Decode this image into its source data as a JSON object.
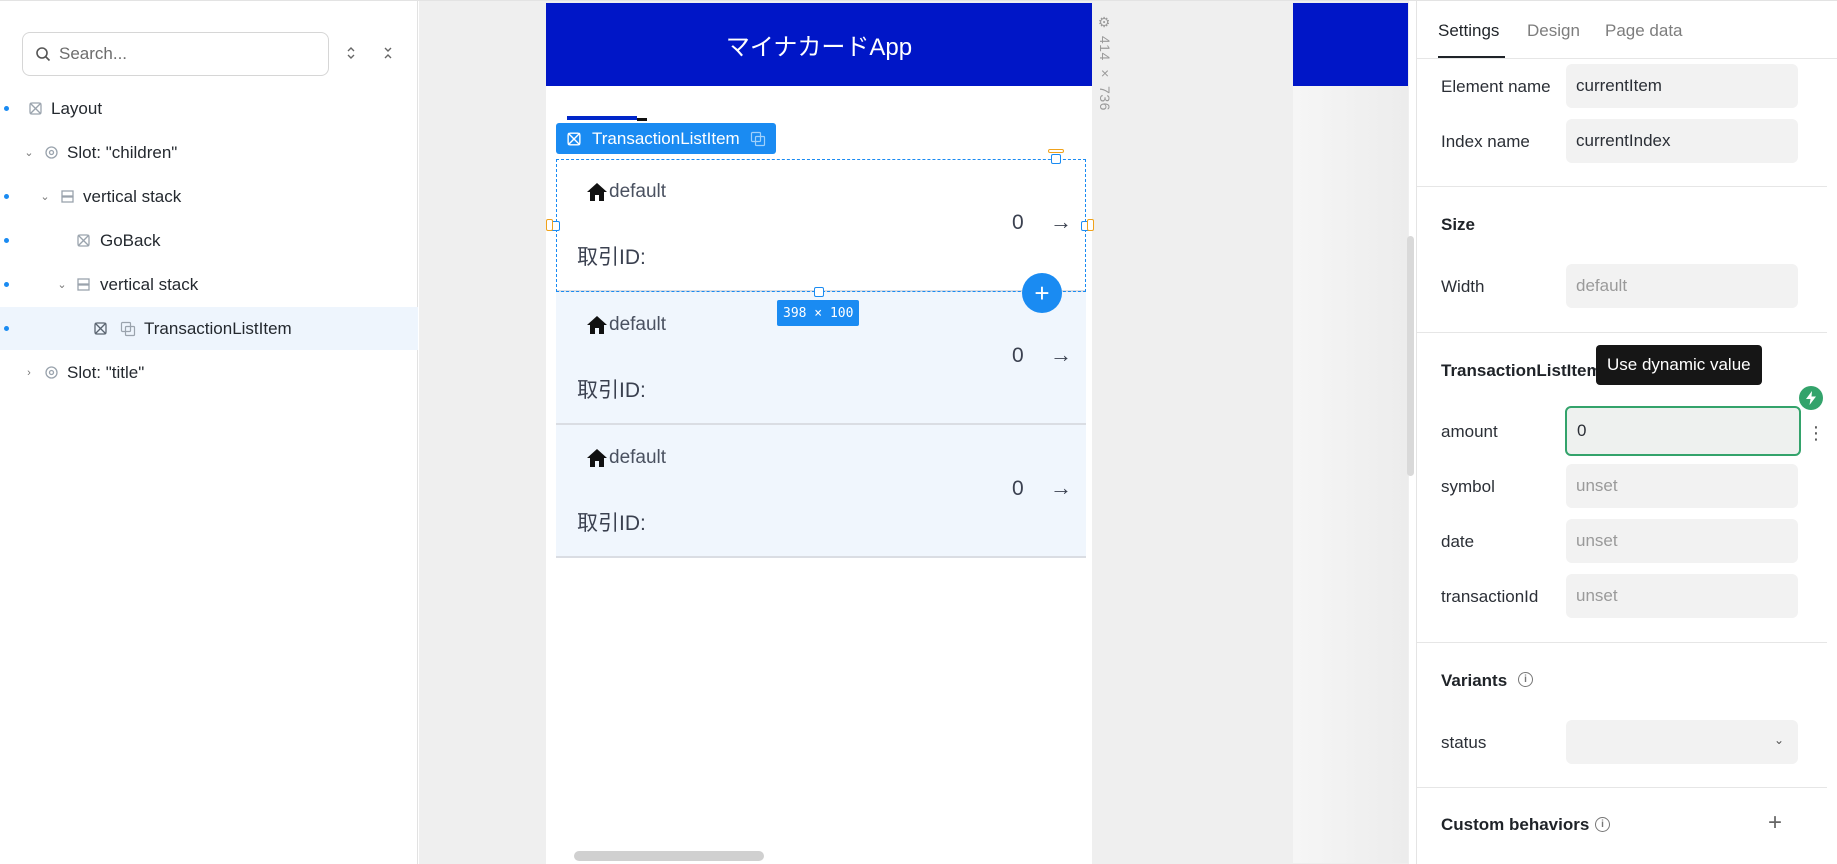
{
  "layers": {
    "search_placeholder": "Search...",
    "items": [
      {
        "label": "Layout",
        "icon": "component-icon"
      },
      {
        "label": "Slot: \"children\"",
        "icon": "slot-icon"
      },
      {
        "label": "vertical stack",
        "icon": "stack-icon"
      },
      {
        "label": "GoBack",
        "icon": "component-icon"
      },
      {
        "label": "vertical stack",
        "icon": "stack-icon"
      },
      {
        "label": "TransactionListItem",
        "icon": "component-icon"
      },
      {
        "label": "Slot: \"title\"",
        "icon": "slot-icon"
      }
    ]
  },
  "canvas": {
    "app_title": "マイナカードApp",
    "device_size": "414 × 736",
    "selection_label": "TransactionListItem",
    "selection_size": "398 × 100",
    "items": [
      {
        "symbol": "default",
        "amount": "0",
        "arrow": "→",
        "id_label": "取引ID:"
      },
      {
        "symbol": "default",
        "amount": "0",
        "arrow": "→",
        "id_label": "取引ID:"
      },
      {
        "symbol": "default",
        "amount": "0",
        "arrow": "→",
        "id_label": "取引ID:"
      }
    ],
    "add_symbol": "+"
  },
  "settings": {
    "tabs": [
      "Settings",
      "Design",
      "Page data"
    ],
    "element_name_label": "Element name",
    "element_name_value": "currentItem",
    "index_name_label": "Index name",
    "index_name_value": "currentIndex",
    "size_title": "Size",
    "width_label": "Width",
    "width_placeholder": "default",
    "component_title": "TransactionListItem",
    "tooltip": "Use dynamic value",
    "amount_label": "amount",
    "amount_value": "0",
    "symbol_label": "symbol",
    "symbol_placeholder": "unset",
    "date_label": "date",
    "date_placeholder": "unset",
    "transaction_id_label": "transactionId",
    "transaction_id_placeholder": "unset",
    "variants_title": "Variants",
    "status_label": "status",
    "status_value": "",
    "custom_behaviors_title": "Custom behaviors",
    "add_symbol": "+"
  },
  "colors": {
    "brand_header": "#0016c7",
    "selection": "#1a8bf2",
    "dynamic": "#33a36b"
  }
}
